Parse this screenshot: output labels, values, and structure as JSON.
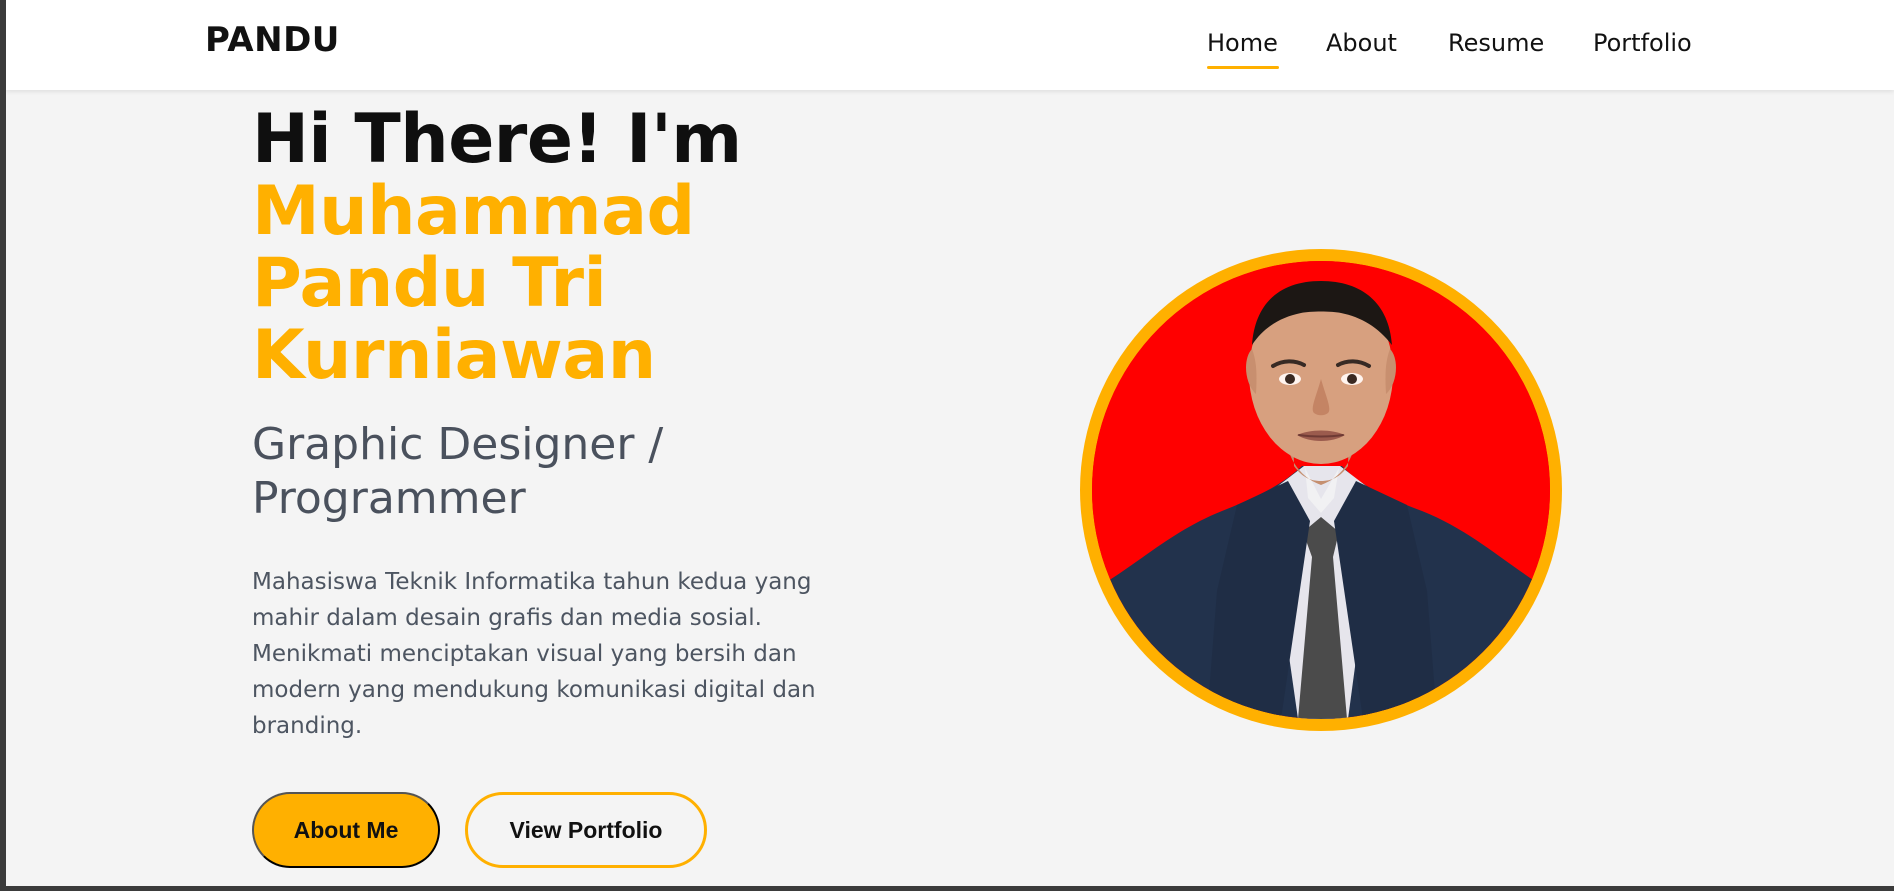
{
  "brand": {
    "name": "PANDU"
  },
  "nav": {
    "items": [
      {
        "label": "Home"
      },
      {
        "label": "About"
      },
      {
        "label": "Resume"
      },
      {
        "label": "Portfolio"
      }
    ],
    "active": "Home"
  },
  "hero": {
    "greeting": "Hi There! I'm",
    "name_lines": [
      "Muhammad",
      "Pandu Tri",
      "Kurniawan"
    ],
    "role_lines": [
      "Graphic Designer /",
      "Programmer"
    ],
    "description": "Mahasiswa Teknik Informatika tahun kedua yang mahir dalam desain grafis dan media sosial. Menikmati menciptakan visual yang bersih dan modern yang mendukung komunikasi digital dan branding.",
    "buttons": {
      "primary": "About Me",
      "secondary": "View Portfolio"
    }
  },
  "profile_image": {
    "icon": "profile-photo",
    "background_color": "#ff0000",
    "ring_color": "#ffb000"
  },
  "colors": {
    "accent": "#ffb000",
    "page_background": "#f4f4f4",
    "text_primary": "#111111",
    "text_secondary": "#4d5561"
  }
}
